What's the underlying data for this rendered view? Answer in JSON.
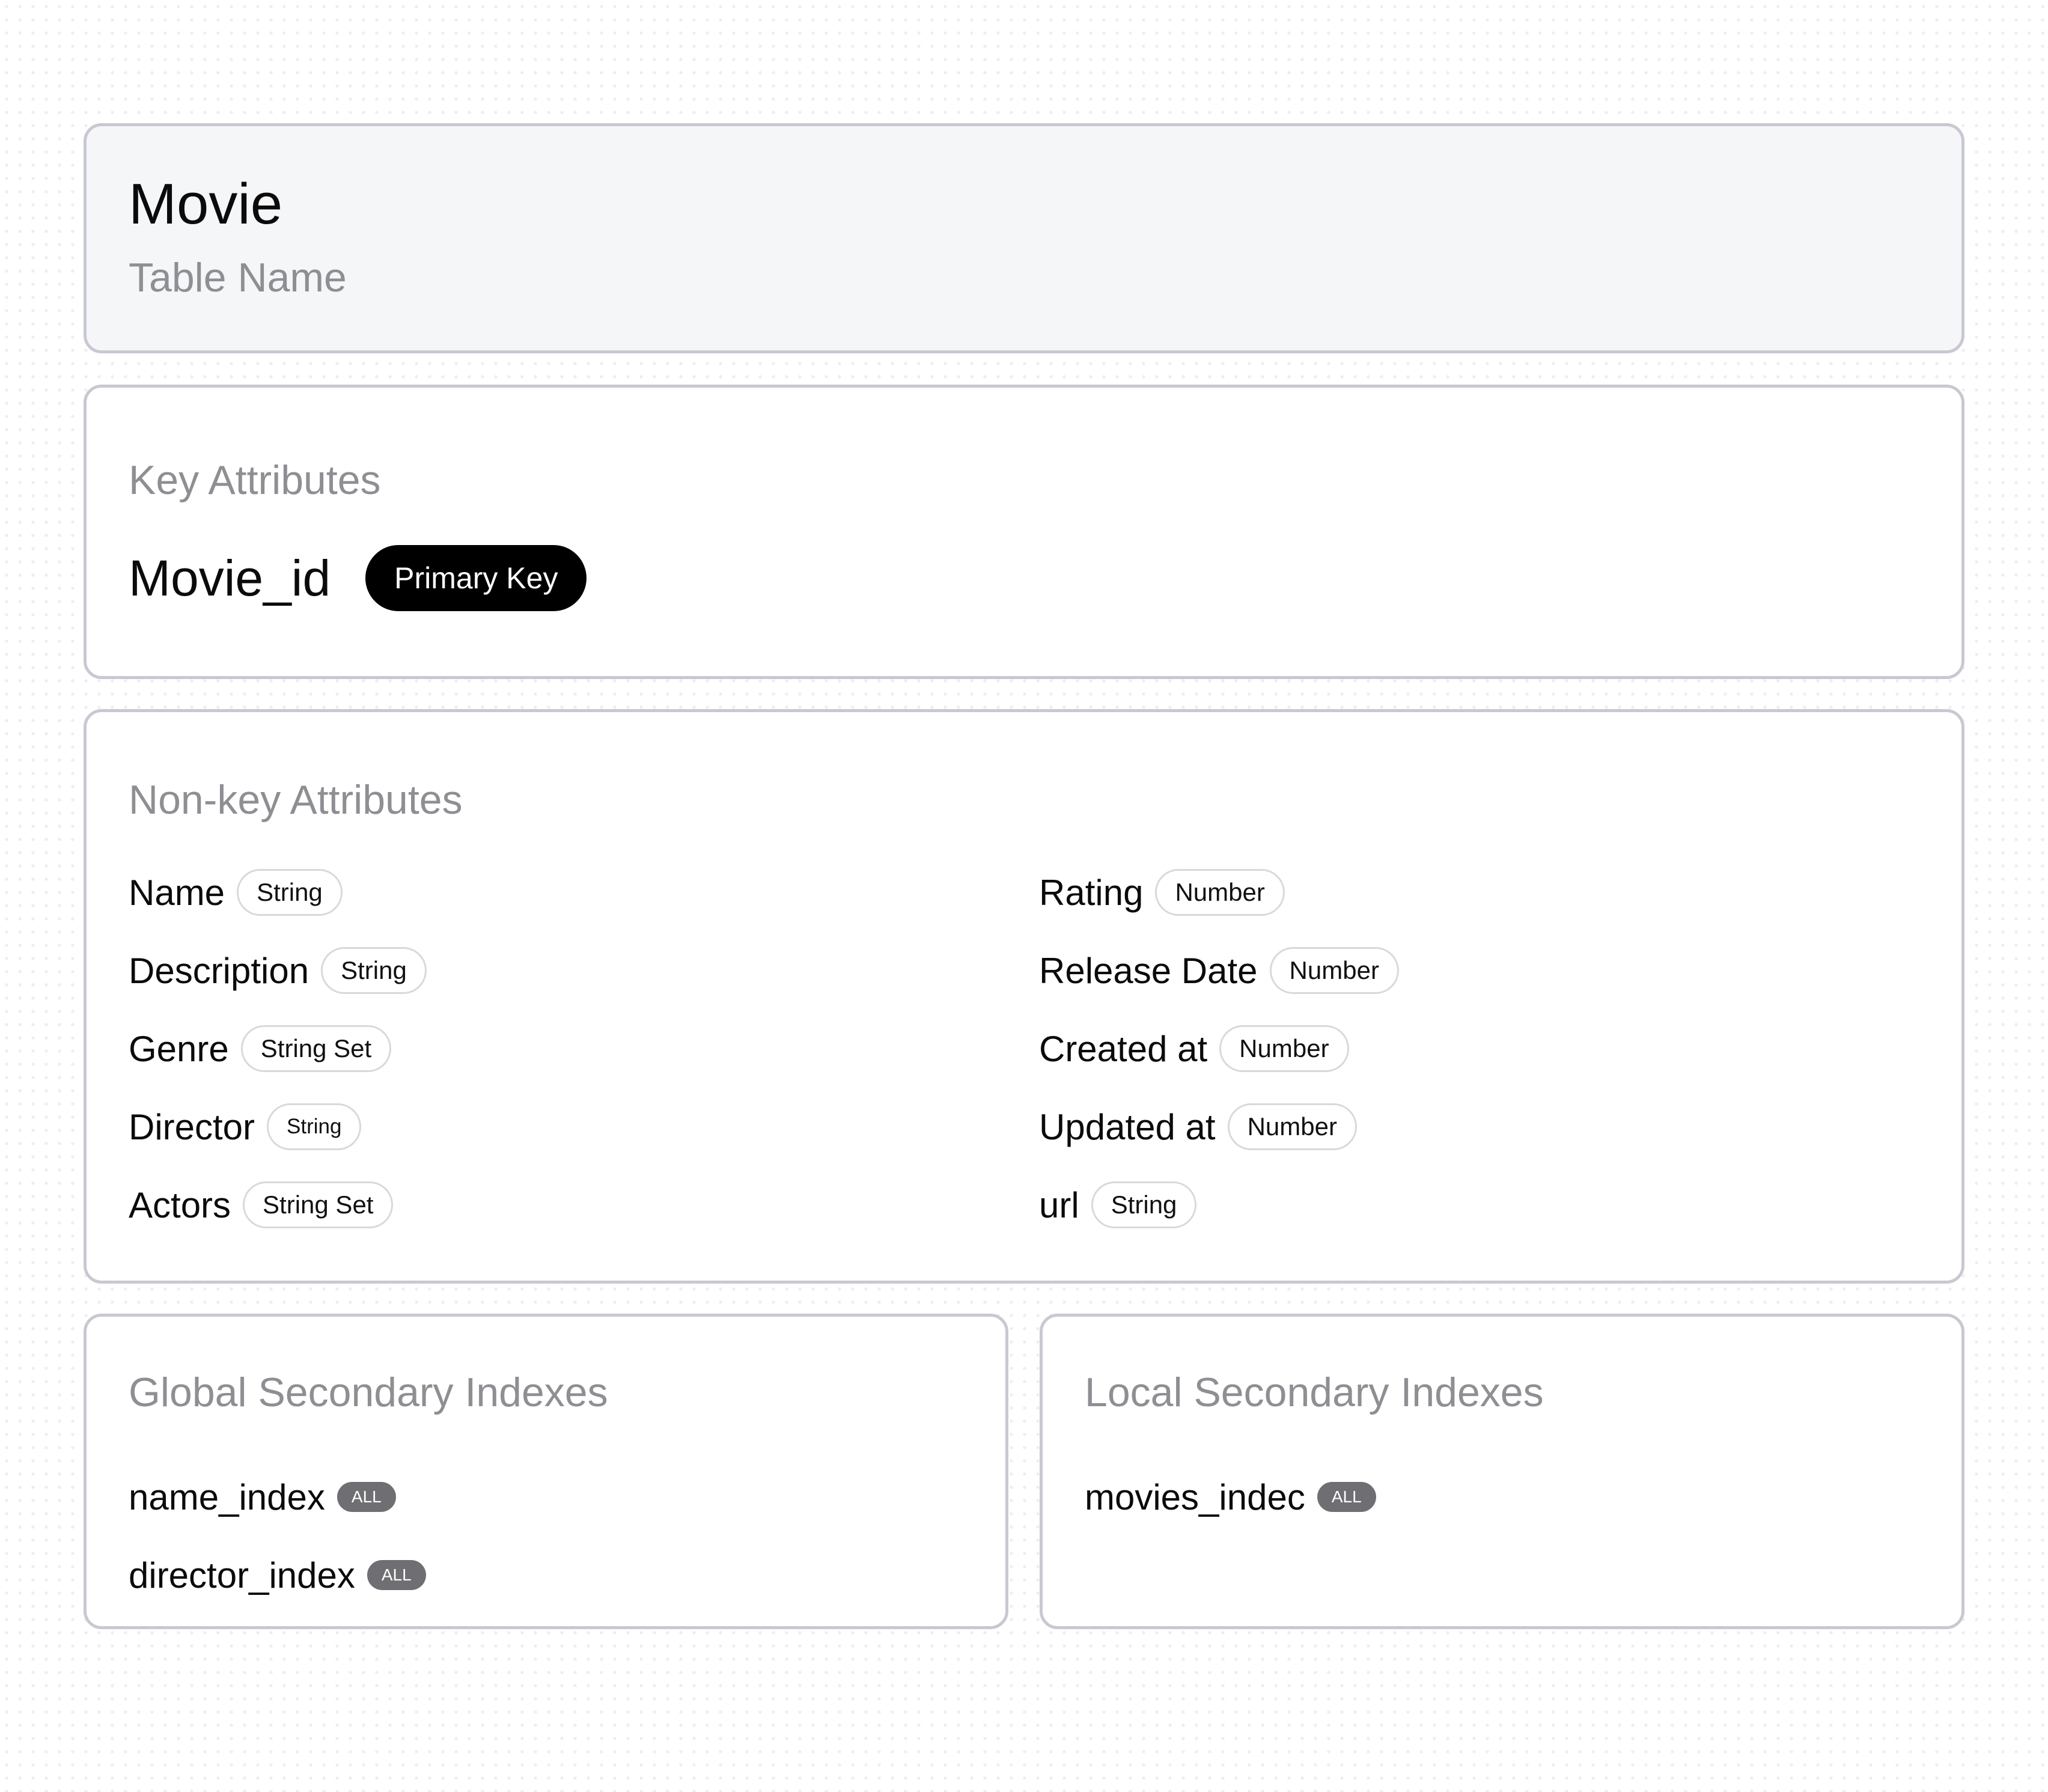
{
  "table": {
    "name": "Movie",
    "label": "Table Name"
  },
  "key_attributes": {
    "heading": "Key Attributes",
    "name": "Movie_id",
    "badge": "Primary Key"
  },
  "non_key_attributes": {
    "heading": "Non-key Attributes",
    "left": [
      {
        "name": "Name",
        "type": "String"
      },
      {
        "name": "Description",
        "type": "String"
      },
      {
        "name": "Genre",
        "type": "String Set"
      },
      {
        "name": "Director",
        "type": "String"
      },
      {
        "name": "Actors",
        "type": "String Set"
      }
    ],
    "right": [
      {
        "name": "Rating",
        "type": "Number"
      },
      {
        "name": "Release Date",
        "type": "Number"
      },
      {
        "name": "Created at",
        "type": "Number"
      },
      {
        "name": "Updated at",
        "type": "Number"
      },
      {
        "name": "url",
        "type": "String"
      }
    ]
  },
  "global_secondary_indexes": {
    "heading": "Global Secondary Indexes",
    "items": [
      {
        "name": "name_index",
        "projection": "ALL"
      },
      {
        "name": "director_index",
        "projection": "ALL"
      }
    ]
  },
  "local_secondary_indexes": {
    "heading": "Local Secondary Indexes",
    "items": [
      {
        "name": "movies_indec",
        "projection": "ALL"
      }
    ]
  }
}
